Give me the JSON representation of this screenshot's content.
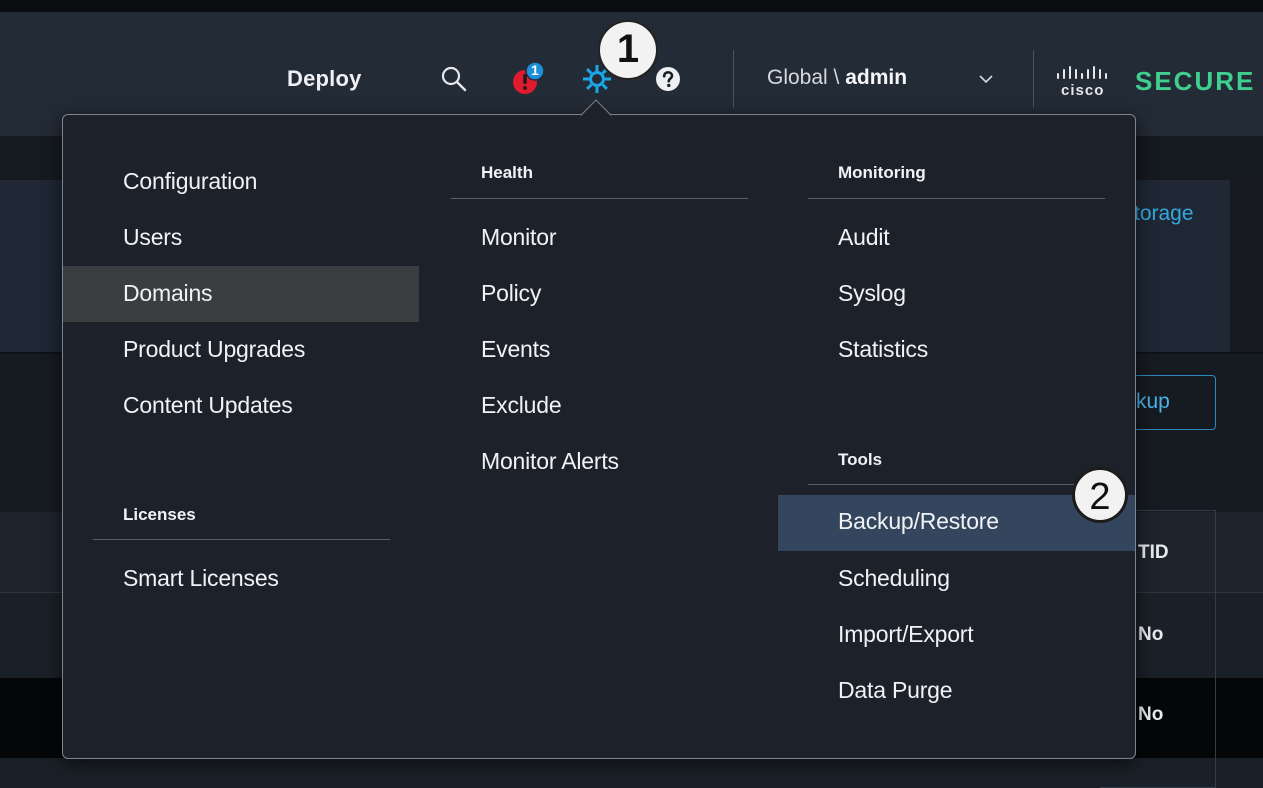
{
  "header": {
    "deploy_label": "Deploy",
    "alert_count": "1",
    "domain_prefix": "Global \\ ",
    "domain_user": "admin",
    "brand_text": "SECURE",
    "brand_logo_text": "cisco"
  },
  "callouts": {
    "one": "1",
    "two": "2"
  },
  "background": {
    "storage_fragment": "torage",
    "backup_button_fragment": "kup",
    "table": {
      "header_fragment": "TID",
      "rows": [
        "No",
        "No"
      ]
    }
  },
  "menu": {
    "col1": {
      "items": [
        "Configuration",
        "Users",
        "Domains",
        "Product Upgrades",
        "Content Updates"
      ],
      "licenses_heading": "Licenses",
      "licenses_items": [
        "Smart Licenses"
      ]
    },
    "col2": {
      "heading": "Health",
      "items": [
        "Monitor",
        "Policy",
        "Events",
        "Exclude",
        "Monitor Alerts"
      ]
    },
    "col3": {
      "monitoring_heading": "Monitoring",
      "monitoring_items": [
        "Audit",
        "Syslog",
        "Statistics"
      ],
      "tools_heading": "Tools",
      "tools_items": [
        "Backup/Restore",
        "Scheduling",
        "Import/Export",
        "Data Purge"
      ]
    }
  },
  "colors": {
    "header_bg": "#232b36",
    "menu_bg": "#1d222a",
    "highlight_hover": "#3b3d40",
    "highlight_selected": "#34465e",
    "gear_accent": "#1ba6e5",
    "alert_red": "#e01b2f",
    "badge_blue": "#1b8fd8",
    "brand_green": "#3fcf8e"
  },
  "icons": [
    "search-icon",
    "alert-icon",
    "gear-icon",
    "help-icon",
    "chevron-down-icon",
    "cisco-logo-icon"
  ]
}
